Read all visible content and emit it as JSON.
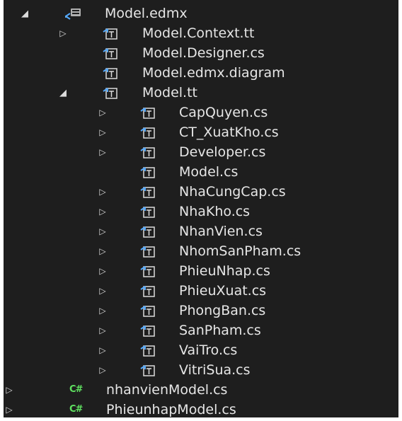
{
  "colors": {
    "background": "#1e1e1e",
    "text": "#e6e6e6",
    "tt_icon": "#55aaff",
    "csharp_icon": "#5fe060"
  },
  "tree": {
    "edmx": {
      "label": "Model.edmx",
      "icon": "edmx-model-icon",
      "state": "expanded"
    },
    "context_tt": {
      "label": "Model.Context.tt",
      "icon": "text-template-icon",
      "state": "collapsed"
    },
    "designer": {
      "label": "Model.Designer.cs",
      "icon": "text-template-icon"
    },
    "diagram": {
      "label": "Model.edmx.diagram",
      "icon": "text-template-icon"
    },
    "model_tt": {
      "label": "Model.tt",
      "icon": "text-template-icon",
      "state": "expanded"
    },
    "model_tt_children": [
      {
        "label": "CapQuyen.cs",
        "expandable": true
      },
      {
        "label": "CT_XuatKho.cs",
        "expandable": true
      },
      {
        "label": "Developer.cs",
        "expandable": true
      },
      {
        "label": "Model.cs",
        "expandable": false
      },
      {
        "label": "NhaCungCap.cs",
        "expandable": true
      },
      {
        "label": "NhaKho.cs",
        "expandable": true
      },
      {
        "label": "NhanVien.cs",
        "expandable": true
      },
      {
        "label": "NhomSanPham.cs",
        "expandable": true
      },
      {
        "label": "PhieuNhap.cs",
        "expandable": true
      },
      {
        "label": "PhieuXuat.cs",
        "expandable": true
      },
      {
        "label": "PhongBan.cs",
        "expandable": true
      },
      {
        "label": "SanPham.cs",
        "expandable": true
      },
      {
        "label": "VaiTro.cs",
        "expandable": true
      },
      {
        "label": "VitriSua.cs",
        "expandable": true
      }
    ],
    "nhanvien_model": {
      "label": "nhanvienModel.cs",
      "icon_text": "C#",
      "state": "collapsed"
    },
    "phieunhap_model": {
      "label": "PhieunhapModel.cs",
      "icon_text": "C#",
      "state": "collapsed"
    }
  },
  "glyphs": {
    "expanded": "◢",
    "collapsed": "▷"
  }
}
